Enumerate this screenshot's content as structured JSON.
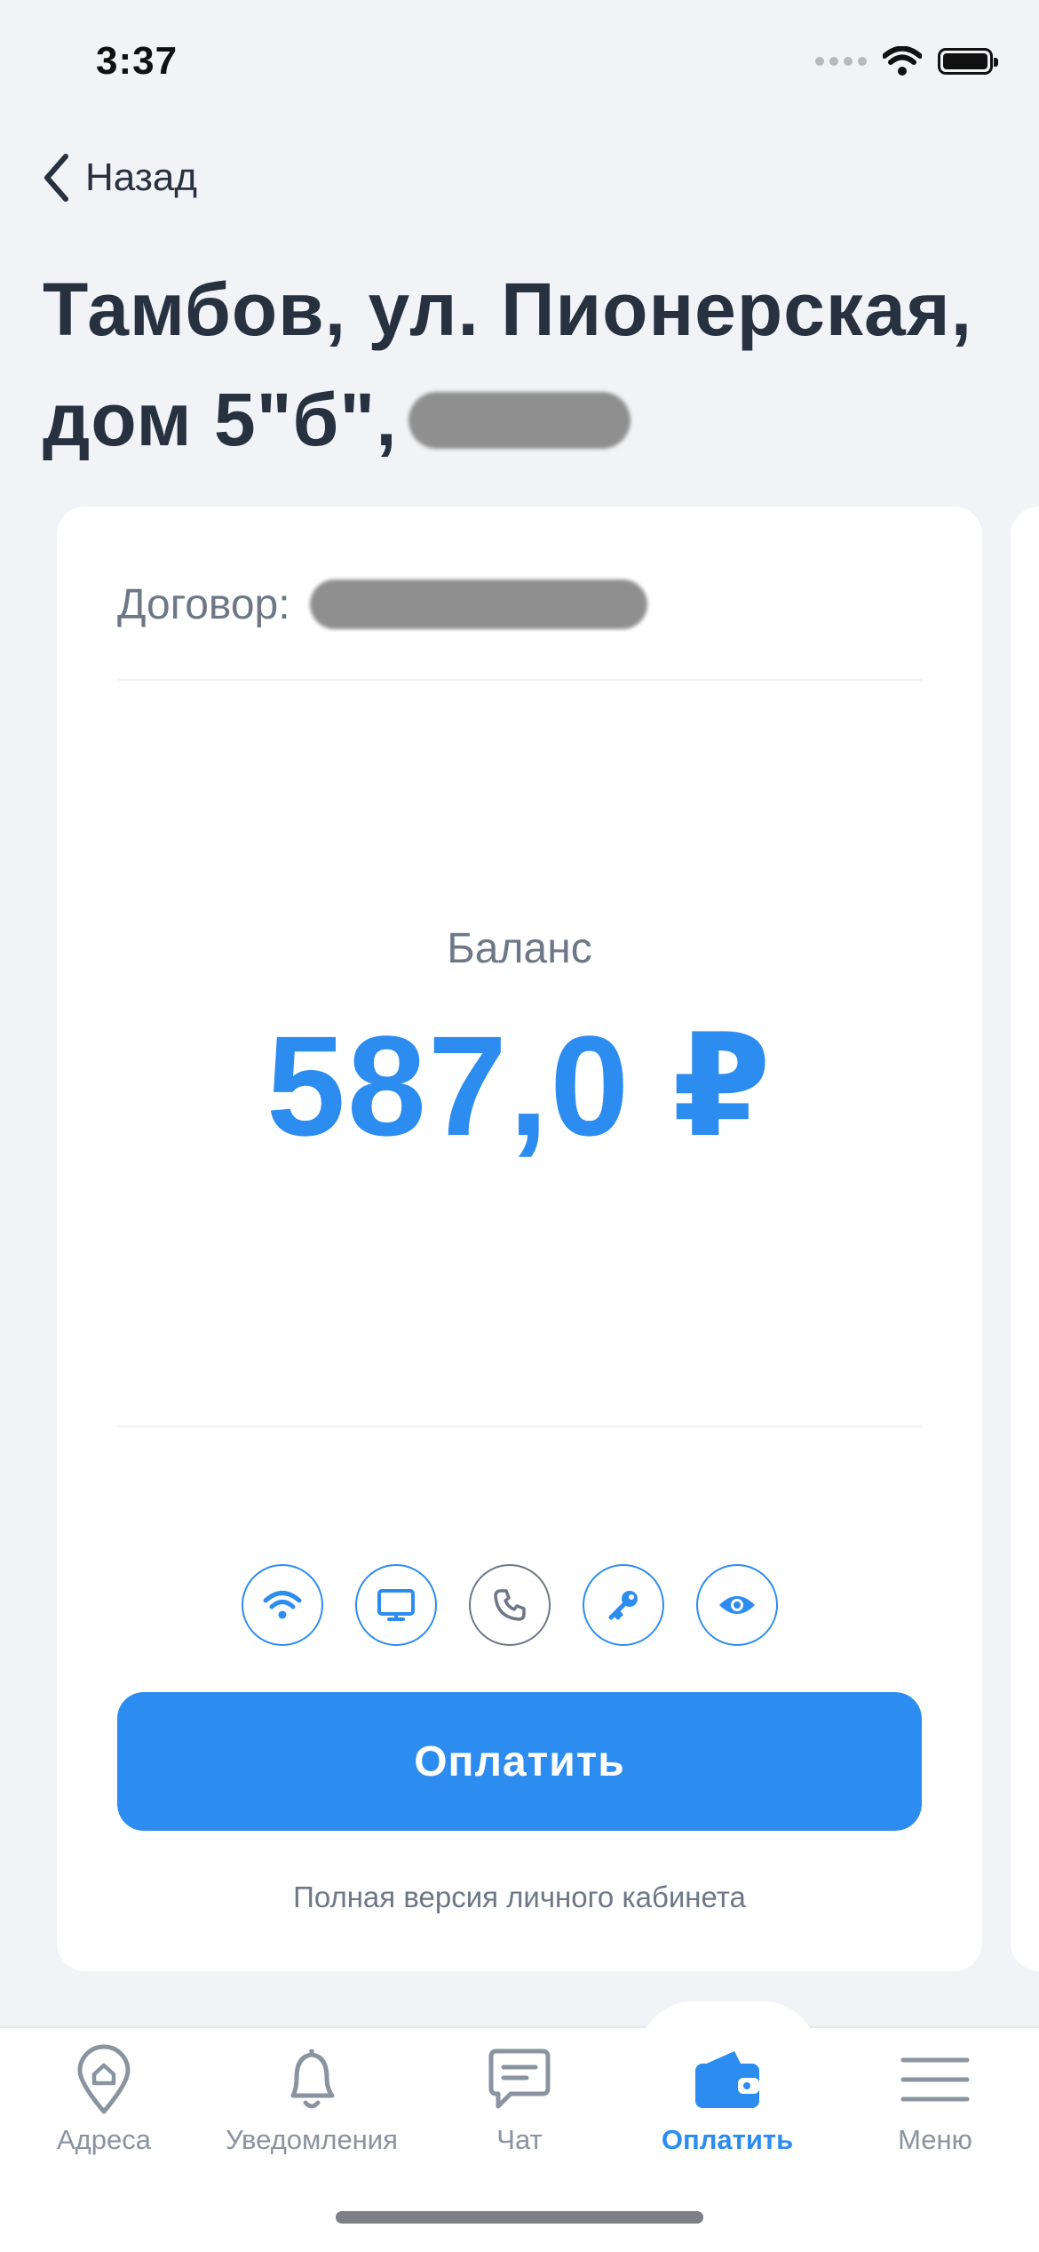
{
  "status_bar": {
    "time": "3:37"
  },
  "nav": {
    "back_label": "Назад"
  },
  "title": {
    "line1": "Тамбов, ул. Пионерская,",
    "line2_prefix": "дом 5\"б\","
  },
  "card": {
    "contract_label": "Договор:",
    "balance_label": "Баланс",
    "balance_value": "587,0 ₽",
    "services": [
      "wifi-icon",
      "tv-icon",
      "phone-icon",
      "key-icon",
      "eye-icon"
    ],
    "pay_label": "Оплатить",
    "full_version_link": "Полная версия личного кабинета"
  },
  "tabbar": {
    "items": [
      {
        "label": "Адреса",
        "icon": "address-pin-icon",
        "active": false
      },
      {
        "label": "Уведомления",
        "icon": "bell-icon",
        "active": false
      },
      {
        "label": "Чат",
        "icon": "chat-icon",
        "active": false
      },
      {
        "label": "Оплатить",
        "icon": "wallet-icon",
        "active": true
      },
      {
        "label": "Меню",
        "icon": "menu-icon",
        "active": false
      }
    ]
  },
  "colors": {
    "accent": "#2d8cf0",
    "text": "#27313f",
    "muted": "#6d7787",
    "background": "#f2f3f7"
  }
}
